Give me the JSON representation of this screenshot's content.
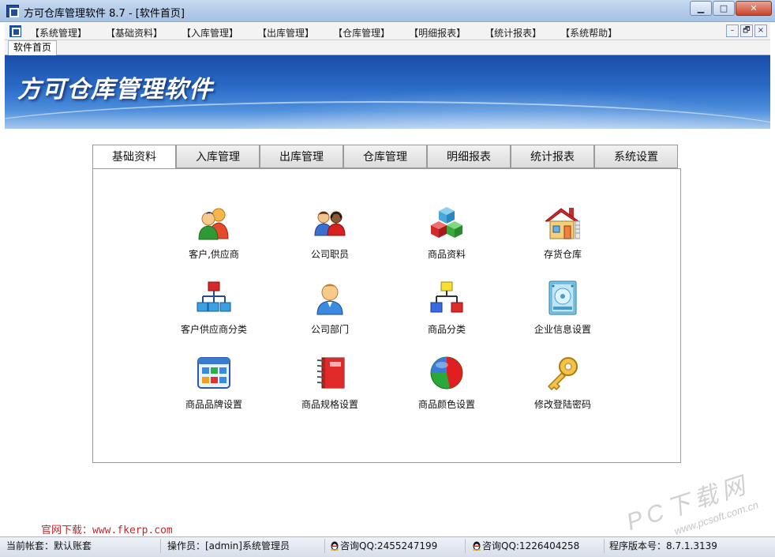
{
  "window": {
    "title": "方可仓库管理软件 8.7 - [软件首页]",
    "minimize": "▁",
    "maximize": "□",
    "close": "✕"
  },
  "menu": {
    "items": [
      "【系统管理】",
      "【基础资料】",
      "【入库管理】",
      "【出库管理】",
      "【仓库管理】",
      "【明细报表】",
      "【统计报表】",
      "【系统帮助】"
    ],
    "mdi_min": "–",
    "mdi_restore": "🗗",
    "mdi_close": "×"
  },
  "doc_tab": "软件首页",
  "banner_title": "方可仓库管理软件",
  "tabs": [
    "基础资料",
    "入库管理",
    "出库管理",
    "仓库管理",
    "明细报表",
    "统计报表",
    "系统设置"
  ],
  "active_tab": "基础资料",
  "items": [
    {
      "label": "客户,供应商",
      "icon": "customers-supplier-icon"
    },
    {
      "label": "公司职员",
      "icon": "staff-icon"
    },
    {
      "label": "商品资料",
      "icon": "cubes-icon"
    },
    {
      "label": "存货仓库",
      "icon": "warehouse-house-icon"
    },
    {
      "label": "客户供应商分类",
      "icon": "org-tree-blue-icon"
    },
    {
      "label": "公司部门",
      "icon": "department-person-icon"
    },
    {
      "label": "商品分类",
      "icon": "org-tree-color-icon"
    },
    {
      "label": "企业信息设置",
      "icon": "hard-disk-icon"
    },
    {
      "label": "商品品牌设置",
      "icon": "app-window-icon"
    },
    {
      "label": "商品规格设置",
      "icon": "red-notebook-icon"
    },
    {
      "label": "商品颜色设置",
      "icon": "color-pie-icon"
    },
    {
      "label": "修改登陆密码",
      "icon": "key-icon"
    }
  ],
  "website": "官网下载：www.fkerp.com",
  "watermark": "PC下载网",
  "watermark_url": "www.pcsoft.com.cn",
  "status": {
    "account": "当前帐套：默认账套",
    "operator": "操作员：[admin]系统管理员",
    "qq1": "咨询QQ:2455247199",
    "qq2": "咨询QQ:1226404258",
    "version": "程序版本号：8.7.1.3139"
  }
}
